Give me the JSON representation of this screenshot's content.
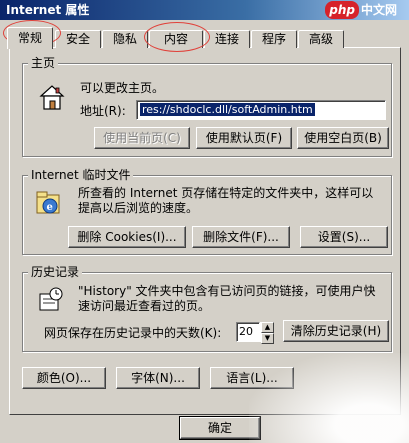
{
  "window": {
    "title": "Internet 属性"
  },
  "watermark": {
    "logo": "php",
    "text": "中文网"
  },
  "tabs": [
    {
      "label": "常规"
    },
    {
      "label": "安全"
    },
    {
      "label": "隐私"
    },
    {
      "label": "内容"
    },
    {
      "label": "连接"
    },
    {
      "label": "程序"
    },
    {
      "label": "高级"
    }
  ],
  "homepage": {
    "legend": "主页",
    "description": "可以更改主页。",
    "address_label": "地址(R):",
    "address_value": "res://shdoclc.dll/softAdmin.htm",
    "buttons": {
      "use_current": "使用当前页(C)",
      "use_default": "使用默认页(F)",
      "use_blank": "使用空白页(B)"
    }
  },
  "temp_files": {
    "legend": "Internet 临时文件",
    "description_line1": "所查看的 Internet 页存储在特定的文件夹中，这样可以",
    "description_line2": "提高以后浏览的速度。",
    "buttons": {
      "delete_cookies": "删除 Cookies(I)...",
      "delete_files": "删除文件(F)...",
      "settings": "设置(S)..."
    }
  },
  "history": {
    "legend": "历史记录",
    "description_line1": "\"History\" 文件夹中包含有已访问页的链接，可使用户快",
    "description_line2": "速访问最近查看过的页。",
    "days_label": "网页保存在历史记录中的天数(K):",
    "days_value": "20",
    "clear_button": "清除历史记录(H)"
  },
  "bottom_buttons": {
    "colors": "颜色(O)...",
    "fonts": "字体(N)...",
    "languages": "语言(L)..."
  },
  "dialog_buttons": {
    "ok": "确定"
  },
  "colors": {
    "titlebar": "#0a246a",
    "selection": "#0a246a",
    "annotation": "#e0413a",
    "face": "#d4d0c8"
  }
}
